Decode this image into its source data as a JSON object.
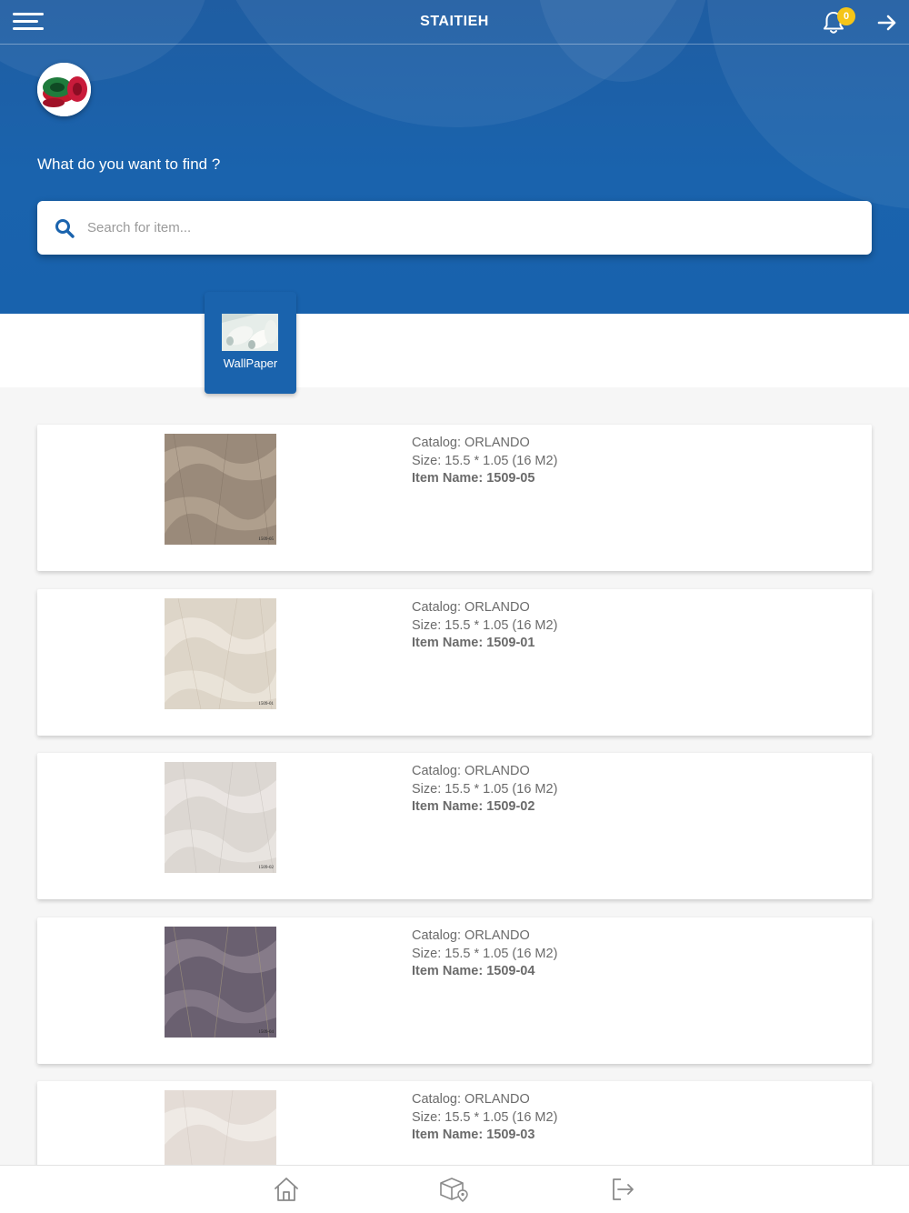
{
  "header": {
    "title": "STAITIEH",
    "notification_count": "0",
    "prompt": "What do you want to find ?"
  },
  "search": {
    "placeholder": "Search for item..."
  },
  "categories": [
    {
      "label": "WallPaper",
      "icon": "wallpaper-rolls-thumbnail"
    }
  ],
  "products": [
    {
      "catalog": "Catalog: ORLANDO",
      "size": "Size: 15.5 * 1.05 (16 M2)",
      "item_name": "Item Name: 1509-05",
      "code": "1509-05",
      "base": "#9a8a7a",
      "tone": "#b8a896"
    },
    {
      "catalog": "Catalog: ORLANDO",
      "size": "Size: 15.5 * 1.05 (16 M2)",
      "item_name": "Item Name: 1509-01",
      "code": "1509-01",
      "base": "#ddd5c8",
      "tone": "#ece6dc"
    },
    {
      "catalog": "Catalog: ORLANDO",
      "size": "Size: 15.5 * 1.05 (16 M2)",
      "item_name": "Item Name: 1509-02",
      "code": "1509-02",
      "base": "#dcd7d2",
      "tone": "#ebe7e3"
    },
    {
      "catalog": "Catalog: ORLANDO",
      "size": "Size: 15.5 * 1.05 (16 M2)",
      "item_name": "Item Name: 1509-04",
      "code": "1509-04",
      "base": "#6a6070",
      "tone": "#8d8290"
    },
    {
      "catalog": "Catalog: ORLANDO",
      "size": "Size: 15.5 * 1.05 (16 M2)",
      "item_name": "Item Name: 1509-03",
      "code": "1509-03",
      "base": "#e4dcd6",
      "tone": "#f0ebe7"
    }
  ],
  "bottom_nav": [
    {
      "name": "home",
      "icon": "home-icon"
    },
    {
      "name": "catalog-location",
      "icon": "box-location-icon"
    },
    {
      "name": "logout",
      "icon": "logout-icon"
    }
  ],
  "colors": {
    "primary": "#1a63ad",
    "badge": "#f5c518",
    "text_muted": "#6b6b6b"
  }
}
